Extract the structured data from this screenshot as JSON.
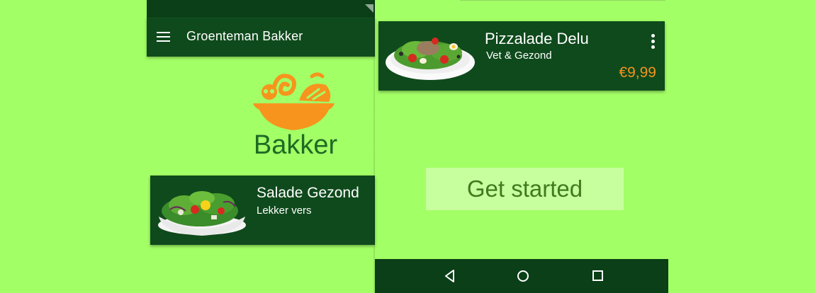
{
  "colors": {
    "background": "#a3ff66",
    "app_bar": "#0f4a1c",
    "status_bar": "#0a3f17",
    "card": "#0f4a1c",
    "logo_orange": "#f7941d",
    "logo_text": "#1e6b24",
    "price": "#f5921e",
    "button_bg": "#c8ff9e",
    "button_text": "#3f7a1e"
  },
  "left_screen": {
    "app_bar": {
      "menu_icon": "hamburger-menu-icon",
      "title": "Groenteman Bakker"
    },
    "logo": {
      "icon": "salad-bowl-icon",
      "label": "Bakker"
    },
    "card": {
      "image": "salad-bowl-image",
      "title": "Salade Gezond",
      "subtitle": "Lekker vers"
    }
  },
  "right_screen": {
    "card": {
      "image": "tuna-salad-plate-image",
      "title": "Pizzalade Delu",
      "subtitle": "Vet & Gezond",
      "price": "€9,99",
      "menu_icon": "more-vertical-icon"
    },
    "cta": {
      "label": "Get started"
    },
    "nav_bar": {
      "back_icon": "back-triangle-icon",
      "home_icon": "home-circle-icon",
      "recent_icon": "recent-apps-square-icon"
    }
  }
}
